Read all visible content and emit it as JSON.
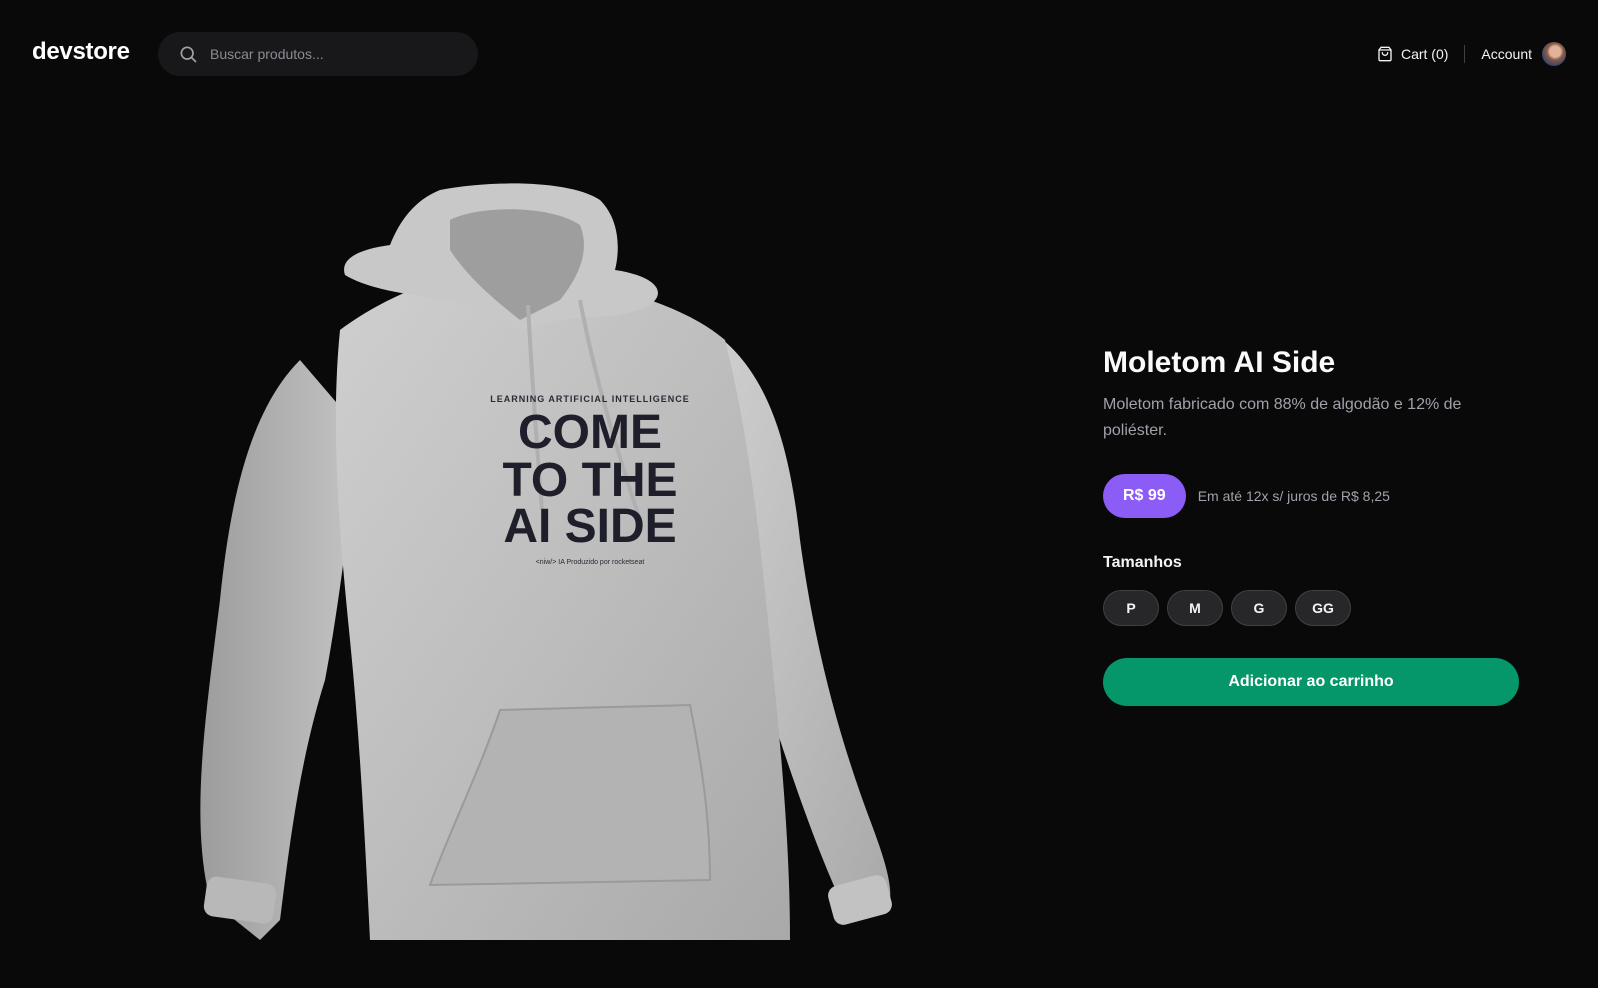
{
  "header": {
    "logo": "devstore",
    "search": {
      "placeholder": "Buscar produtos...",
      "icon": "search-icon"
    },
    "cart": {
      "label": "Cart (0)",
      "icon": "shopping-bag-icon"
    },
    "account": {
      "label": "Account"
    }
  },
  "product": {
    "image": {
      "print_top": "LEARNING ARTIFICIAL INTELLIGENCE",
      "print_line1": "COME",
      "print_line2": "TO THE",
      "print_line3": "AI SIDE",
      "print_footer": "<niw/> IA  Produzido por rocketseat"
    },
    "title": "Moletom AI Side",
    "description": "Moletom fabricado com 88% de algodão e 12% de poliéster.",
    "price": "R$ 99",
    "installments": "Em até 12x s/ juros de R$ 8,25",
    "sizes_label": "Tamanhos",
    "sizes": [
      "P",
      "M",
      "G",
      "GG"
    ],
    "add_to_cart": "Adicionar ao carrinho"
  },
  "colors": {
    "background": "#09090a",
    "price_badge": "#8b5cf6",
    "add_button": "#059669"
  }
}
